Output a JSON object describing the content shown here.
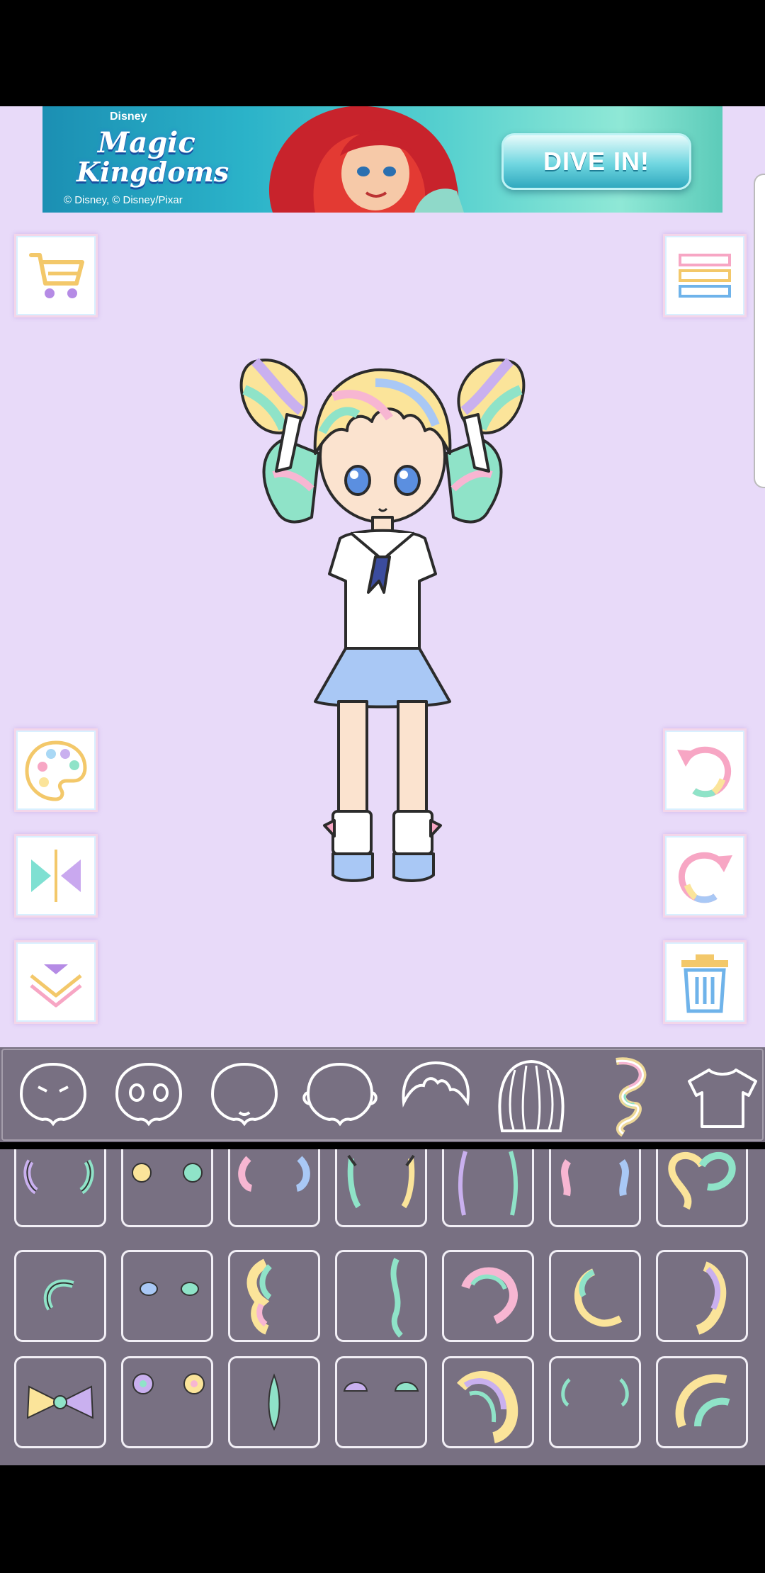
{
  "ad": {
    "brand_small": "Disney",
    "brand_line1": "Magic",
    "brand_line2": "Kingdoms",
    "copyright": "© Disney, © Disney/Pixar",
    "cta": "DIVE IN!"
  },
  "toolbar_left": [
    "cart-icon",
    "palette-icon",
    "mirror-icon",
    "collapse-icon"
  ],
  "toolbar_right": [
    "menu-icon",
    "undo-icon",
    "redo-icon",
    "trash-icon"
  ],
  "colors": {
    "canvas": "#e8daf9",
    "panel": "#787082",
    "pastel_pink": "#f7b6d2",
    "pastel_yellow": "#fbe49a",
    "pastel_mint": "#8fe3c8",
    "pastel_blue": "#a9c8f5",
    "pastel_purple": "#c9b0ef"
  },
  "categories": [
    {
      "name": "face-expression",
      "selected": false
    },
    {
      "name": "eyes",
      "selected": false
    },
    {
      "name": "mouth",
      "selected": false
    },
    {
      "name": "ears",
      "selected": false
    },
    {
      "name": "front-hair",
      "selected": false
    },
    {
      "name": "back-hair",
      "selected": false
    },
    {
      "name": "side-hair",
      "selected": true
    },
    {
      "name": "top",
      "selected": false
    }
  ],
  "items": {
    "row1": [
      "twin-tails",
      "twin-buns",
      "side-curls",
      "ribbon-braids",
      "long-side-strands",
      "side-twists",
      "heart-loop"
    ],
    "row2": [
      "single-curl",
      "twin-small-buns",
      "big-side-curl",
      "long-single-strand",
      "hook-curl",
      "crescent-curl",
      "side-sweep"
    ],
    "row3": [
      "bow",
      "twin-rose-buns",
      "thin-strand",
      "twin-shell-buns",
      "big-wave",
      "thin-crescents",
      "double-crescent"
    ]
  }
}
